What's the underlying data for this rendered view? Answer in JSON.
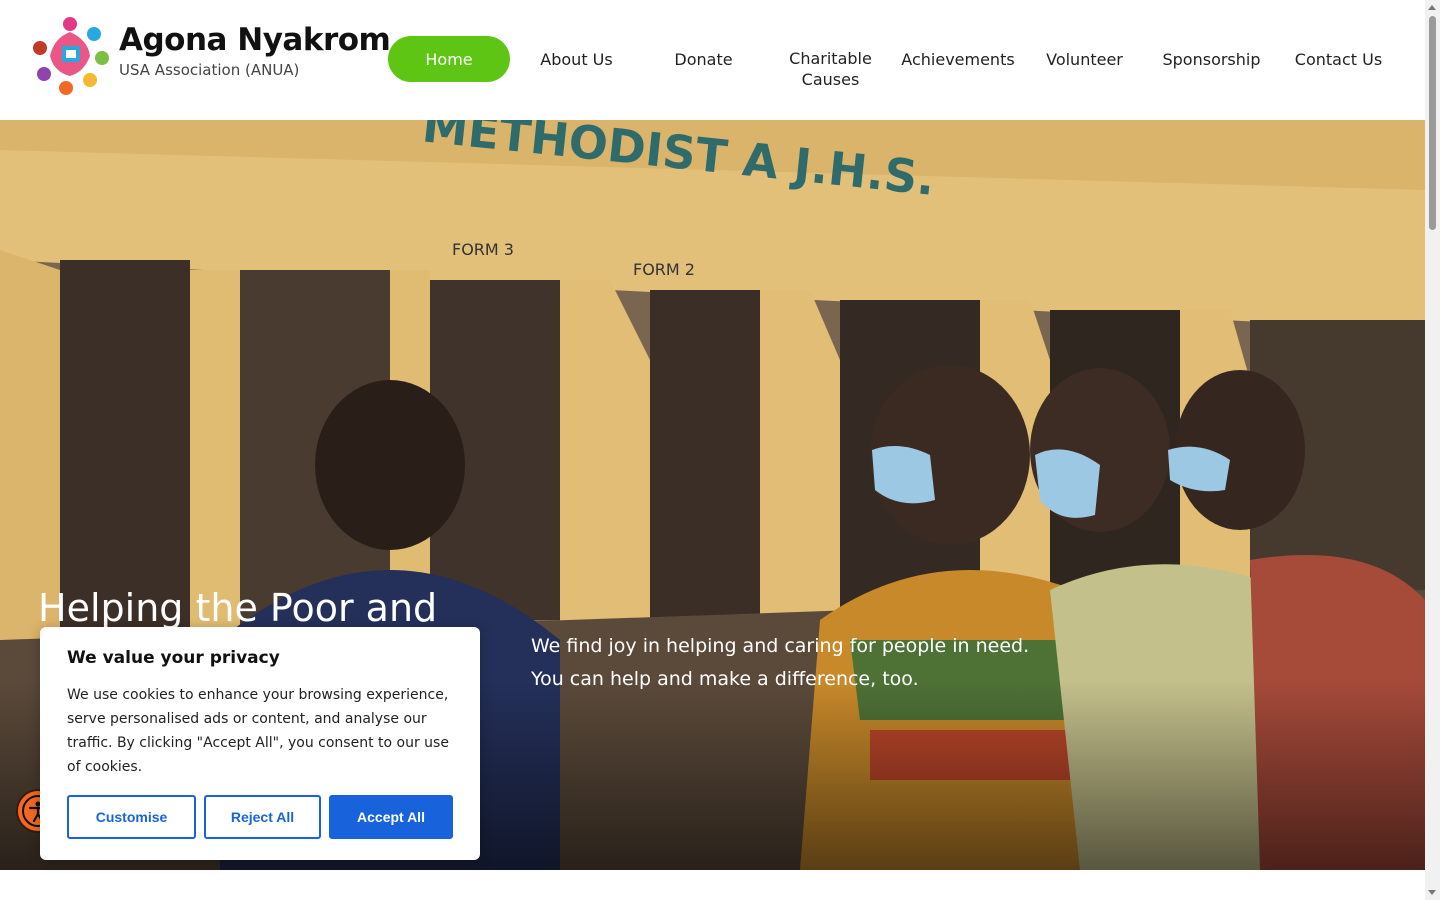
{
  "brand": {
    "title": "Agona Nyakrom",
    "subtitle": "USA Association (ANUA)"
  },
  "nav": {
    "items": [
      {
        "label": "Home",
        "active": true
      },
      {
        "label": "About Us"
      },
      {
        "label": "Donate"
      },
      {
        "label": "Charitable Causes"
      },
      {
        "label": "Achievements"
      },
      {
        "label": "Volunteer"
      },
      {
        "label": "Sponsorship"
      },
      {
        "label": "Contact Us"
      }
    ]
  },
  "hero": {
    "heading": "Helping the Poor and",
    "text_line1": "We find joy in helping and caring for people in need.",
    "text_line2": "You can help and make a difference, too.",
    "image_sign": "METHODIST A J.H.S.",
    "image_room_labels": [
      "FORM 3",
      "FORM 2"
    ]
  },
  "cookie": {
    "title": "We value your privacy",
    "body": "We use cookies to enhance your browsing experience, serve personalised ads or content, and analyse our traffic. By clicking \"Accept All\", you consent to our use of cookies.",
    "customise_label": "Customise",
    "reject_label": "Reject All",
    "accept_label": "Accept All"
  },
  "colors": {
    "nav_active": "#5ec514",
    "cookie_button": "#1863dc",
    "a11y_button": "#f26a21"
  },
  "icons": {
    "accessibility": "accessibility-icon",
    "logo": "anua-logo"
  }
}
